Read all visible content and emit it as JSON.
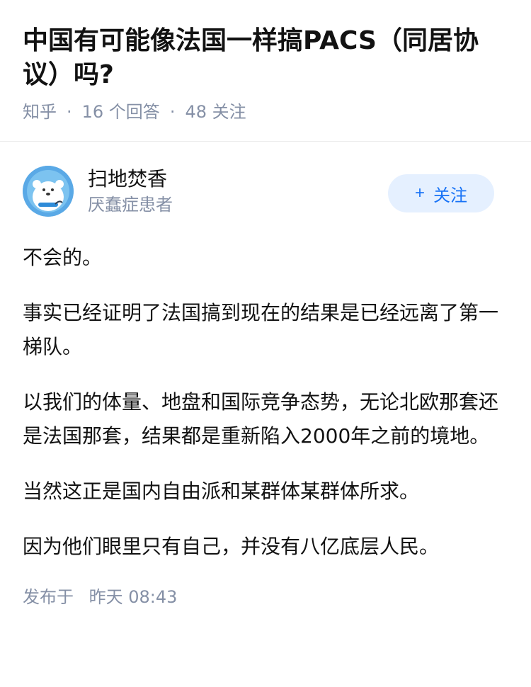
{
  "question": {
    "title": "中国有可能像法国一样搞PACS（同居协议）吗?",
    "source": "知乎",
    "answers_count": "16 个回答",
    "followers_count": "48 关注"
  },
  "answer": {
    "author": {
      "name": "扫地焚香",
      "bio": "厌蠢症患者",
      "avatar_icon": "polar-bear-avatar"
    },
    "follow_button": {
      "plus": "+",
      "label": "关注"
    },
    "paragraphs": [
      "不会的。",
      "事实已经证明了法国搞到现在的结果是已经远离了第一梯队。",
      "以我们的体量、地盘和国际竞争态势，无论北欧那套还是法国那套，结果都是重新陷入2000年之前的境地。",
      "当然这正是国内自由派和某群体某群体所求。",
      "因为他们眼里只有自己，并没有八亿底层人民。"
    ],
    "publish_label": "发布于",
    "publish_time": "昨天 08:43"
  },
  "colors": {
    "primary": "#1772f6",
    "muted": "#8590a6",
    "button_bg": "#e5f0ff",
    "text": "#121212"
  }
}
